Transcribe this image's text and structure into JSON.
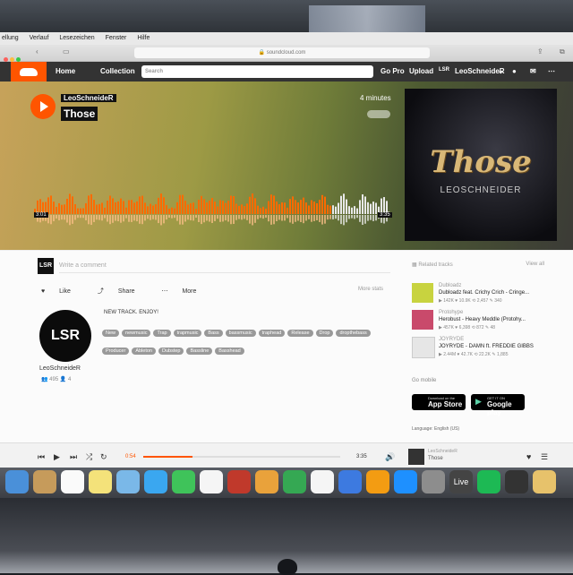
{
  "menubar": [
    "ellung",
    "Verlauf",
    "Lesezeichen",
    "Fenster",
    "Hilfe"
  ],
  "browser": {
    "url": "soundcloud.com"
  },
  "header": {
    "home": "Home",
    "collection": "Collection",
    "search_placeholder": "Search",
    "gopro": "Go Pro",
    "upload": "Upload",
    "lsr": "LSR",
    "user": "LeoSchneideR"
  },
  "track": {
    "artist": "LeoSchneideR",
    "title": "Those",
    "ago": "4 minutes",
    "time_current": "3:01",
    "time_total": "3:35",
    "cover_title": "Those",
    "cover_artist": "LEOSCHNEIDER"
  },
  "waveform": {
    "played_fraction": 0.84
  },
  "comment": {
    "avatar": "LSR",
    "placeholder": "Write a comment"
  },
  "actions": {
    "like": "Like",
    "share": "Share",
    "more": "More",
    "more_stats": "More stats"
  },
  "profile": {
    "avatar": "LSR",
    "name": "LeoSchneideR",
    "followers": "495",
    "following": "4"
  },
  "description": "NEW TRACK. ENJOY!",
  "tags": [
    "New",
    "newmusic",
    "Trap",
    "trapmusic",
    "Bass",
    "bassmusic",
    "traphead",
    "Release",
    "Drop",
    "dropthebass",
    "Producer",
    "Ableton",
    "Dubstep",
    "Bassline",
    "Basshead"
  ],
  "sidebar": {
    "related_header": "Related tracks",
    "view_all": "View all",
    "tracks": [
      {
        "artist": "Dubloadz",
        "title": "Dubloadz feat. Crichy Crich - Cringe...",
        "plays": "142K",
        "likes": "10.9K",
        "reposts": "2,457",
        "comments": "340",
        "color": "#c8d33f"
      },
      {
        "artist": "Protohype",
        "title": "Herobust - Heavy Meddle (Protohy...",
        "plays": "457K",
        "likes": "6,398",
        "reposts": "872",
        "comments": "48",
        "color": "#c94a6b"
      },
      {
        "artist": "JOYRYDE",
        "title": "JOYRYDE - DAMN ft. FREDDIE GIBBS",
        "plays": "2.44M",
        "likes": "42.7K",
        "reposts": "22.2K",
        "comments": "1,885",
        "color": "#e6e6e6"
      }
    ],
    "go_mobile": "Go mobile",
    "appstore_small": "Download on the",
    "appstore": "App Store",
    "googleplay_small": "GET IT ON",
    "googleplay": "Google play",
    "language": "Language: English (US)"
  },
  "player": {
    "time_current": "0:54",
    "time_total": "3:35",
    "track_artist": "LeoSchneideR",
    "track_title": "Those",
    "progress_fraction": 0.25
  },
  "dock_icons": [
    "finder-icon",
    "contacts-icon",
    "calendar-icon",
    "notes-icon",
    "preview-icon",
    "messages-icon",
    "facetime-icon",
    "photos-icon",
    "photobooth-icon",
    "pages-icon",
    "numbers-icon",
    "itunes-icon",
    "keynote-icon",
    "ibooks-icon",
    "appstore-icon",
    "settings-icon",
    "live-icon",
    "spotify-icon",
    "s-icon",
    "folder-icon"
  ],
  "dock_live": "Live"
}
